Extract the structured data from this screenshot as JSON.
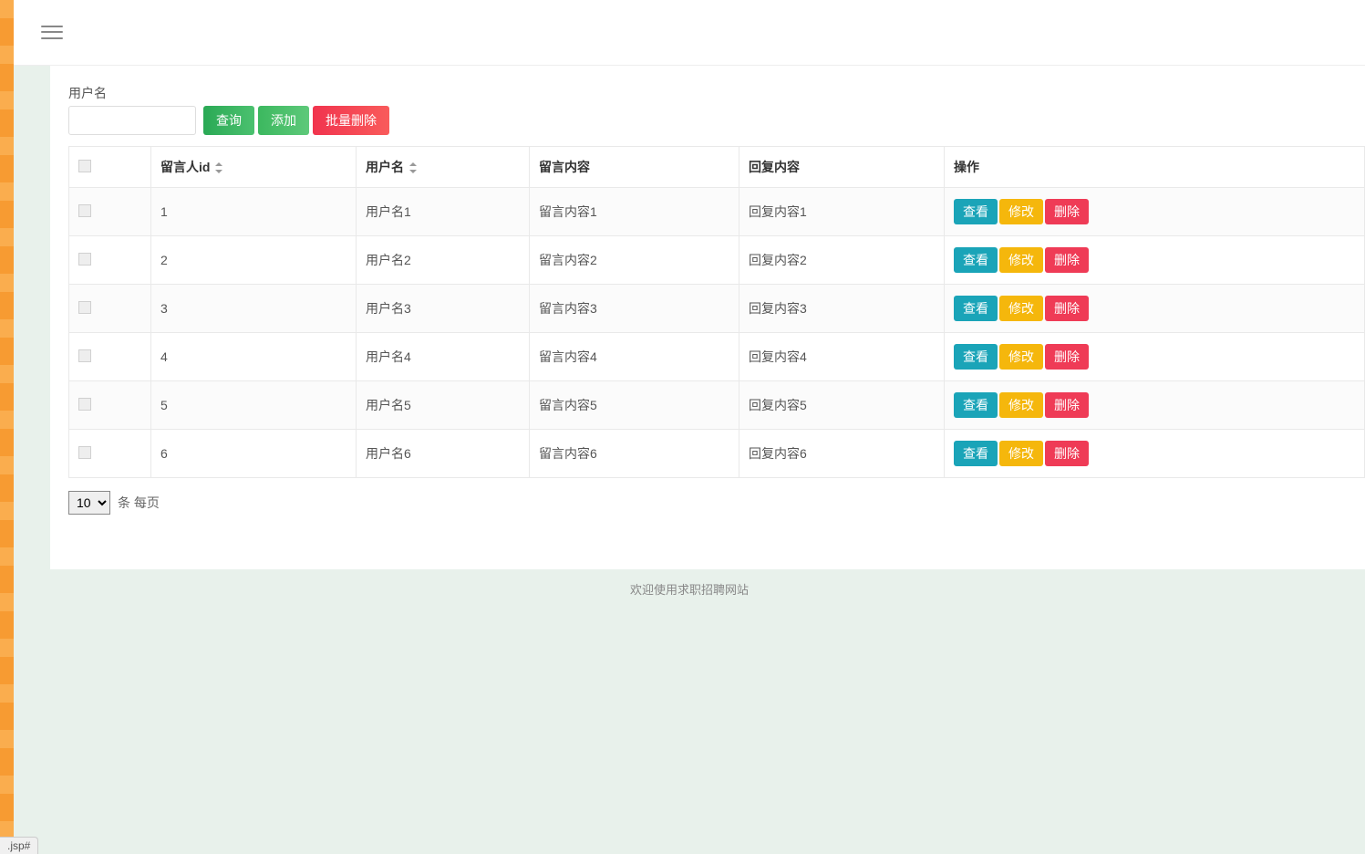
{
  "filter": {
    "username_label": "用户名",
    "username_value": "",
    "query_btn": "查询",
    "add_btn": "添加",
    "batch_delete_btn": "批量删除"
  },
  "table": {
    "headers": {
      "id": "留言人id",
      "username": "用户名",
      "message": "留言内容",
      "reply": "回复内容",
      "action": "操作"
    },
    "rows": [
      {
        "id": "1",
        "username": "用户名1",
        "message": "留言内容1",
        "reply": "回复内容1"
      },
      {
        "id": "2",
        "username": "用户名2",
        "message": "留言内容2",
        "reply": "回复内容2"
      },
      {
        "id": "3",
        "username": "用户名3",
        "message": "留言内容3",
        "reply": "回复内容3"
      },
      {
        "id": "4",
        "username": "用户名4",
        "message": "留言内容4",
        "reply": "回复内容4"
      },
      {
        "id": "5",
        "username": "用户名5",
        "message": "留言内容5",
        "reply": "回复内容5"
      },
      {
        "id": "6",
        "username": "用户名6",
        "message": "留言内容6",
        "reply": "回复内容6"
      }
    ],
    "actions": {
      "view": "查看",
      "edit": "修改",
      "delete": "删除"
    }
  },
  "pager": {
    "page_size_selected": "10",
    "page_size_suffix": "条 每页"
  },
  "footer": {
    "text": "欢迎使用求职招聘网站"
  },
  "status": {
    "text": ".jsp#"
  }
}
